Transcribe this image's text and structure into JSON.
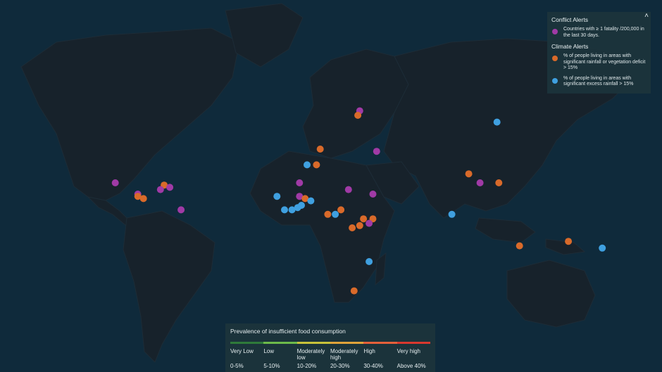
{
  "colors": {
    "ocean": "#0f2a3b",
    "land": "#17222b",
    "conflict": "#a03aa6",
    "climate_deficit": "#d96a2a",
    "climate_excess": "#3fa0e0"
  },
  "alerts_legend": {
    "collapse_icon": "caret-up-icon",
    "conflict_title": "Conflict Alerts",
    "conflict_items": [
      {
        "label": "Countries with ≥ 1 fatality /200,000 in the last 30 days.",
        "color": "#a03aa6"
      }
    ],
    "climate_title": "Climate Alerts",
    "climate_items": [
      {
        "label": "% of people living in areas with significant rainfall or vegetation deficit > 15%",
        "color": "#d96a2a"
      },
      {
        "label": "% of people living in areas with significant excess rainfall > 15%",
        "color": "#3fa0e0"
      }
    ]
  },
  "food_legend": {
    "title": "Prevalence of insufficient food consumption",
    "categories": [
      {
        "name": "Very Low",
        "range": "0-5%",
        "color": "#2f7a3a"
      },
      {
        "name": "Low",
        "range": "5-10%",
        "color": "#6dba4a"
      },
      {
        "name": "Moderately low",
        "range": "10-20%",
        "color": "#c8c23a"
      },
      {
        "name": "Moderately high",
        "range": "20-30%",
        "color": "#e0a33a"
      },
      {
        "name": "High",
        "range": "30-40%",
        "color": "#e5603a"
      },
      {
        "name": "Very high",
        "range": "Above 40%",
        "color": "#d9382e"
      }
    ]
  },
  "markers": [
    {
      "type": "conflict",
      "lon": -99,
      "lat": 20
    },
    {
      "type": "conflict",
      "lon": -87,
      "lat": 15
    },
    {
      "type": "climate_deficit",
      "lon": -87,
      "lat": 14
    },
    {
      "type": "climate_deficit",
      "lon": -84,
      "lat": 13
    },
    {
      "type": "climate_deficit",
      "lon": -73,
      "lat": 19
    },
    {
      "type": "conflict",
      "lon": -75,
      "lat": 17
    },
    {
      "type": "conflict",
      "lon": -70,
      "lat": 18
    },
    {
      "type": "conflict",
      "lon": -64,
      "lat": 8
    },
    {
      "type": "conflict",
      "lon": 31,
      "lat": 52
    },
    {
      "type": "climate_deficit",
      "lon": 30,
      "lat": 50
    },
    {
      "type": "climate_deficit",
      "lon": 10,
      "lat": 35
    },
    {
      "type": "conflict",
      "lon": 40,
      "lat": 34
    },
    {
      "type": "climate_excess",
      "lon": 3,
      "lat": 28
    },
    {
      "type": "climate_deficit",
      "lon": 8,
      "lat": 28
    },
    {
      "type": "conflict",
      "lon": -1,
      "lat": 20
    },
    {
      "type": "climate_excess",
      "lon": -13,
      "lat": 14
    },
    {
      "type": "conflict",
      "lon": -1,
      "lat": 14
    },
    {
      "type": "climate_deficit",
      "lon": 2,
      "lat": 13
    },
    {
      "type": "climate_excess",
      "lon": 5,
      "lat": 12
    },
    {
      "type": "climate_excess",
      "lon": -9,
      "lat": 8
    },
    {
      "type": "climate_excess",
      "lon": -5,
      "lat": 8
    },
    {
      "type": "climate_excess",
      "lon": -2,
      "lat": 9
    },
    {
      "type": "climate_excess",
      "lon": 0,
      "lat": 10
    },
    {
      "type": "climate_deficit",
      "lon": 14,
      "lat": 6
    },
    {
      "type": "climate_excess",
      "lon": 18,
      "lat": 6
    },
    {
      "type": "climate_deficit",
      "lon": 21,
      "lat": 8
    },
    {
      "type": "conflict",
      "lon": 25,
      "lat": 17
    },
    {
      "type": "conflict",
      "lon": 38,
      "lat": 15
    },
    {
      "type": "climate_deficit",
      "lon": 33,
      "lat": 4
    },
    {
      "type": "climate_deficit",
      "lon": 27,
      "lat": 0
    },
    {
      "type": "climate_deficit",
      "lon": 31,
      "lat": 1
    },
    {
      "type": "climate_deficit",
      "lon": 38,
      "lat": 4
    },
    {
      "type": "conflict",
      "lon": 36,
      "lat": 2
    },
    {
      "type": "climate_excess",
      "lon": 36,
      "lat": -15
    },
    {
      "type": "climate_deficit",
      "lon": 28,
      "lat": -28
    },
    {
      "type": "climate_deficit",
      "lon": 89,
      "lat": 24
    },
    {
      "type": "conflict",
      "lon": 95,
      "lat": 20
    },
    {
      "type": "climate_deficit",
      "lon": 105,
      "lat": 20
    },
    {
      "type": "climate_excess",
      "lon": 80,
      "lat": 6
    },
    {
      "type": "climate_excess",
      "lon": 104,
      "lat": 47
    },
    {
      "type": "climate_deficit",
      "lon": 116,
      "lat": -8
    },
    {
      "type": "climate_deficit",
      "lon": 142,
      "lat": -6
    },
    {
      "type": "climate_excess",
      "lon": 160,
      "lat": -9
    }
  ]
}
